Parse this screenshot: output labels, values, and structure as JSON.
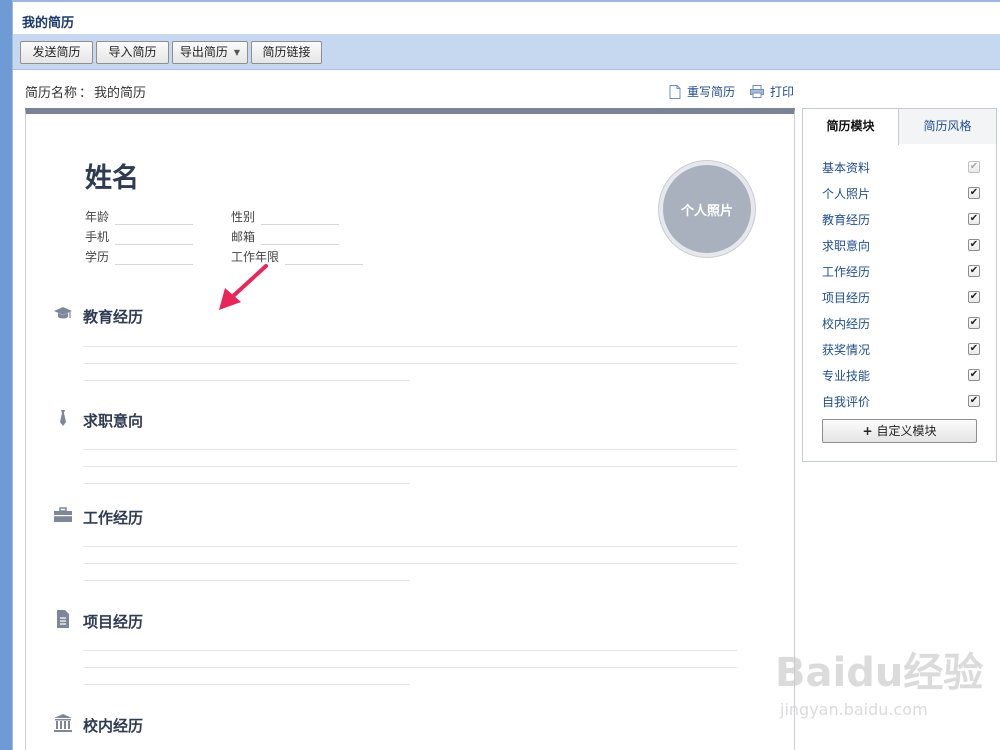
{
  "window": {
    "title": "我的简历"
  },
  "toolbar": {
    "buttons": [
      {
        "label": "发送简历"
      },
      {
        "label": "导入简历"
      },
      {
        "label": "导出简历"
      },
      {
        "label": "简历链接"
      }
    ]
  },
  "resume_name": {
    "label": "简历名称",
    "sep": "：",
    "value": "我的简历"
  },
  "actions": {
    "rewrite": "重写简历",
    "print": "打印"
  },
  "profile": {
    "name": "姓名",
    "fields": [
      "年龄",
      "性别",
      "手机",
      "邮箱",
      "学历",
      "工作年限"
    ],
    "photo": "个人照片"
  },
  "sections": [
    "教育经历",
    "求职意向",
    "工作经历",
    "项目经历",
    "校内经历"
  ],
  "panel": {
    "tabs": [
      "简历模块",
      "简历风格"
    ],
    "modules": [
      "基本资料",
      "个人照片",
      "教育经历",
      "求职意向",
      "工作经历",
      "项目经历",
      "校内经历",
      "获奖情况",
      "专业技能",
      "自我评价"
    ],
    "custom_button": "自定义模块"
  },
  "watermark": {
    "brand": "Baidu经验",
    "url": "jingyan.baidu.com"
  },
  "colors": {
    "accent_blue": "#1f4e8c",
    "toolbar_bg": "#c5d8f0",
    "arrow": "#e8265a"
  }
}
